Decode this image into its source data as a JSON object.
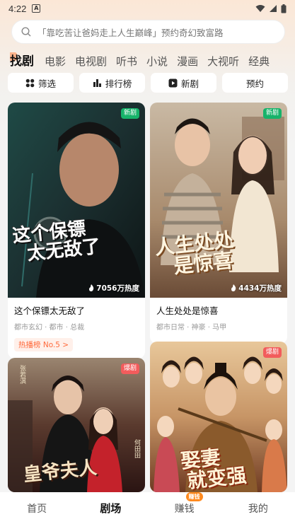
{
  "status": {
    "time": "4:22",
    "a_icon": "A"
  },
  "search": {
    "placeholder": "「靠吃苦让爸妈走上人生巅峰」预约奇幻致富路"
  },
  "category_tabs": [
    "找剧",
    "电影",
    "电视剧",
    "听书",
    "小说",
    "漫画",
    "大视听",
    "经典"
  ],
  "filters": [
    {
      "label": "筛选",
      "icon": "grid-icon"
    },
    {
      "label": "排行榜",
      "icon": "bar-chart-icon"
    },
    {
      "label": "新剧",
      "icon": "play-icon"
    },
    {
      "label": "预约",
      "icon": ""
    }
  ],
  "cards": [
    {
      "poster_text": [
        "这个保镖",
        "太无敌了"
      ],
      "badge": "新剧",
      "heat": "7056万热度",
      "title": "这个保镖太无敌了",
      "tags": "都市玄幻 · 都市 · 总裁",
      "rank": "热播榜 No.5"
    },
    {
      "poster_text": [
        "人生处处",
        "是惊喜"
      ],
      "badge": "新剧",
      "heat": "4434万热度",
      "title": "人生处处是惊喜",
      "tags": "都市日常 · 神豪 · 马甲"
    },
    {
      "poster_text": [
        "皇爷夫人"
      ],
      "badge": "爆剧",
      "small_text": [
        "张若淇",
        "何田田"
      ]
    },
    {
      "poster_text": [
        "娶妻",
        "就变强"
      ],
      "badge": "爆剧"
    }
  ],
  "bottom_nav": [
    {
      "label": "首页"
    },
    {
      "label": "剧场"
    },
    {
      "label": "赚钱",
      "badge": "赚钱"
    },
    {
      "label": "我的"
    }
  ],
  "colors": {
    "accent": "#ff6a3c",
    "badge_green": "#16b36a",
    "badge_red": "#f25c5c"
  }
}
